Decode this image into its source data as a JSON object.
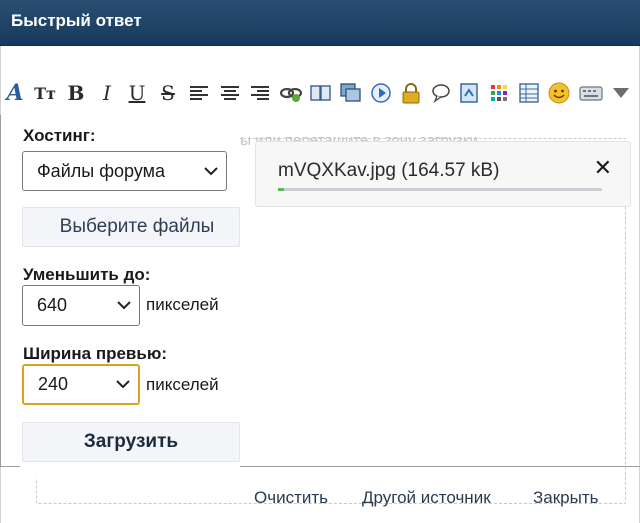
{
  "header": {
    "title": "Быстрый ответ"
  },
  "toolbar": {
    "items": [
      {
        "icon": "font-color-icon",
        "glyph": "A"
      },
      {
        "icon": "font-size-icon",
        "glyph": "Tт"
      },
      {
        "icon": "bold-icon",
        "glyph": "B"
      },
      {
        "icon": "italic-icon",
        "glyph": "I"
      },
      {
        "icon": "underline-icon",
        "glyph": "U"
      },
      {
        "icon": "strikethrough-icon",
        "glyph": "S"
      },
      {
        "icon": "align-left-icon",
        "glyph": ""
      },
      {
        "icon": "align-center-icon",
        "glyph": ""
      },
      {
        "icon": "align-right-icon",
        "glyph": ""
      },
      {
        "icon": "link-icon",
        "glyph": ""
      },
      {
        "icon": "book-icon",
        "glyph": ""
      },
      {
        "icon": "image-icon",
        "glyph": ""
      },
      {
        "icon": "media-play-icon",
        "glyph": ""
      },
      {
        "icon": "lock-icon",
        "glyph": ""
      },
      {
        "icon": "speech-bubble-icon",
        "glyph": ""
      },
      {
        "icon": "upload-icon",
        "glyph": ""
      },
      {
        "icon": "color-grid-icon",
        "glyph": ""
      },
      {
        "icon": "table-icon",
        "glyph": ""
      },
      {
        "icon": "smiley-icon",
        "glyph": ""
      },
      {
        "icon": "keyboard-icon",
        "glyph": ""
      },
      {
        "icon": "dropdown-arrow-icon",
        "glyph": ""
      }
    ]
  },
  "upload": {
    "dropzone_hint": "Выберите файлы или перетащите в зону загрузки",
    "hosting_label": "Хостинг:",
    "hosting_value": "Файлы форума",
    "choose_files_label": "Выберите файлы",
    "resize_label": "Уменьшить до:",
    "resize_value": "640",
    "resize_unit": "пикселей",
    "preview_label": "Ширина превью:",
    "preview_value": "240",
    "preview_unit": "пикселей",
    "upload_button": "Загрузить",
    "file": {
      "name": "mVQXKav.jpg (164.57 kB)",
      "progress": 0.02
    },
    "footer": {
      "clear": "Очистить",
      "other_source": "Другой источник",
      "close": "Закрыть"
    }
  },
  "colors": {
    "header_bg": "#1f4568",
    "focus_border": "#d9a520",
    "progress_fill": "#5cb85c"
  }
}
